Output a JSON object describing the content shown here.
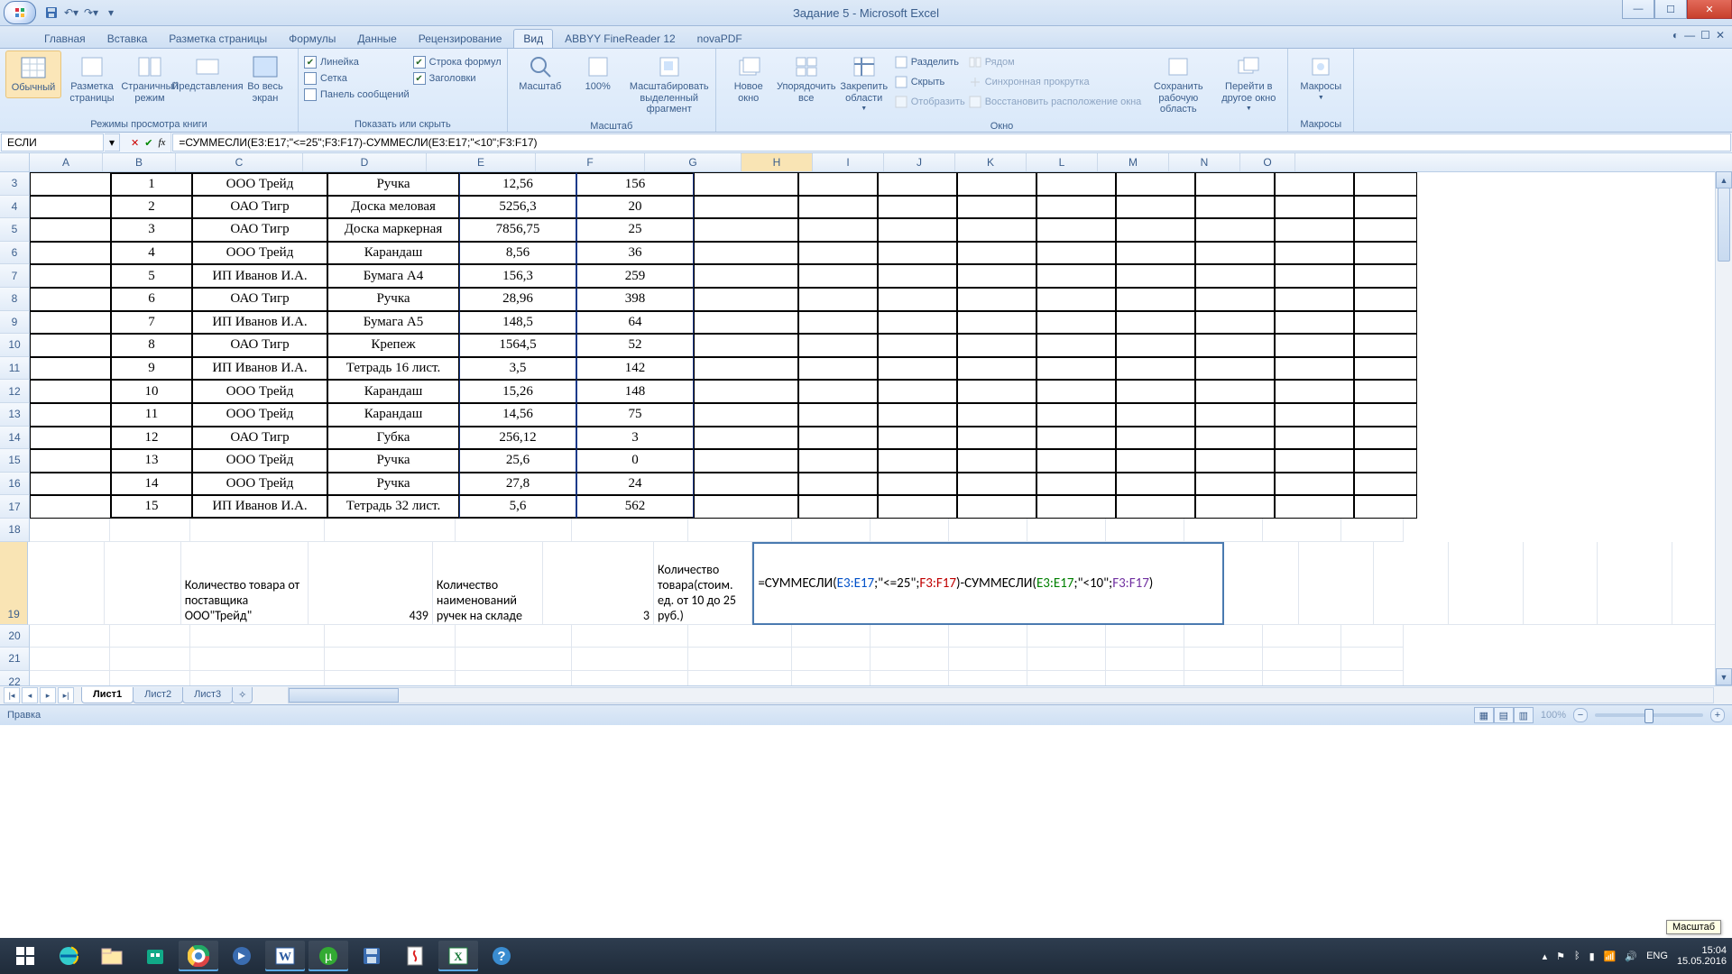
{
  "title": "Задание 5 - Microsoft Excel",
  "tabs": [
    "Главная",
    "Вставка",
    "Разметка страницы",
    "Формулы",
    "Данные",
    "Рецензирование",
    "Вид",
    "ABBYY FineReader 12",
    "novaPDF"
  ],
  "active_tab": "Вид",
  "ribbon": {
    "g1": {
      "label": "Режимы просмотра книги",
      "btns": [
        "Обычный",
        "Разметка страницы",
        "Страничный режим",
        "Представления",
        "Во весь экран"
      ]
    },
    "g2": {
      "label": "Показать или скрыть",
      "chk": [
        {
          "c": true,
          "t": "Линейка"
        },
        {
          "c": true,
          "t": "Строка формул"
        },
        {
          "c": false,
          "t": "Сетка"
        },
        {
          "c": true,
          "t": "Заголовки"
        },
        {
          "c": false,
          "t": "Панель сообщений"
        }
      ]
    },
    "g3": {
      "label": "Масштаб",
      "btns": [
        "Масштаб",
        "100%",
        "Масштабировать выделенный фрагмент"
      ]
    },
    "g4": {
      "label": "Окно",
      "btns": [
        "Новое окно",
        "Упорядочить все",
        "Закрепить области"
      ],
      "rows": [
        "Разделить",
        "Скрыть",
        "Отобразить"
      ],
      "rows2": [
        "Рядом",
        "Синхронная прокрутка",
        "Восстановить расположение окна"
      ],
      "btns2": [
        "Сохранить рабочую область",
        "Перейти в другое окно"
      ]
    },
    "g5": {
      "label": "Макросы",
      "btn": "Макросы"
    }
  },
  "namebox": "ЕСЛИ",
  "formula": "=СУММЕСЛИ(E3:E17;\"<=25\";F3:F17)-СУММЕСЛИ(E3:E17;\"<10\";F3:F17)",
  "columns": [
    "A",
    "B",
    "C",
    "D",
    "E",
    "F",
    "G",
    "H",
    "I",
    "J",
    "K",
    "L",
    "M",
    "N",
    "O"
  ],
  "active_col": "H",
  "rows_visible": [
    3,
    4,
    5,
    6,
    7,
    8,
    9,
    10,
    11,
    12,
    13,
    14,
    15,
    16,
    17,
    18,
    19,
    20,
    21,
    22
  ],
  "active_row": 19,
  "table": [
    {
      "n": "1",
      "sup": "ООО Трейд",
      "item": "Ручка",
      "price": "12,56",
      "qty": "156"
    },
    {
      "n": "2",
      "sup": "ОАО Тигр",
      "item": "Доска меловая",
      "price": "5256,3",
      "qty": "20"
    },
    {
      "n": "3",
      "sup": "ОАО Тигр",
      "item": "Доска маркерная",
      "price": "7856,75",
      "qty": "25"
    },
    {
      "n": "4",
      "sup": "ООО Трейд",
      "item": "Карандаш",
      "price": "8,56",
      "qty": "36"
    },
    {
      "n": "5",
      "sup": "ИП Иванов И.А.",
      "item": "Бумага А4",
      "price": "156,3",
      "qty": "259"
    },
    {
      "n": "6",
      "sup": "ОАО Тигр",
      "item": "Ручка",
      "price": "28,96",
      "qty": "398"
    },
    {
      "n": "7",
      "sup": "ИП Иванов И.А.",
      "item": "Бумага А5",
      "price": "148,5",
      "qty": "64"
    },
    {
      "n": "8",
      "sup": "ОАО Тигр",
      "item": "Крепеж",
      "price": "1564,5",
      "qty": "52"
    },
    {
      "n": "9",
      "sup": "ИП Иванов И.А.",
      "item": "Тетрадь 16 лист.",
      "price": "3,5",
      "qty": "142"
    },
    {
      "n": "10",
      "sup": "ООО Трейд",
      "item": "Карандаш",
      "price": "15,26",
      "qty": "148"
    },
    {
      "n": "11",
      "sup": "ООО Трейд",
      "item": "Карандаш",
      "price": "14,56",
      "qty": "75"
    },
    {
      "n": "12",
      "sup": "ОАО Тигр",
      "item": "Губка",
      "price": "256,12",
      "qty": "3"
    },
    {
      "n": "13",
      "sup": "ООО Трейд",
      "item": "Ручка",
      "price": "25,6",
      "qty": "0"
    },
    {
      "n": "14",
      "sup": "ООО Трейд",
      "item": "Ручка",
      "price": "27,8",
      "qty": "24"
    },
    {
      "n": "15",
      "sup": "ИП Иванов И.А.",
      "item": "Тетрадь 32 лист.",
      "price": "5,6",
      "qty": "562"
    }
  ],
  "summary": {
    "c19": "Количество товара от поставщика ООО\"Трейд\"",
    "d19": "439",
    "e19": "Количество наименований ручек на складе",
    "f19": "3",
    "g19": "Количество товара(стоим. ед. от 10 до 25 руб.)"
  },
  "edit_cell": {
    "parts": [
      {
        "t": "=СУММЕСЛИ(",
        "c": "black"
      },
      {
        "t": "E3:E17",
        "c": "blue"
      },
      {
        "t": ";\"<=25\";",
        "c": "black"
      },
      {
        "t": "F3:F17",
        "c": "red"
      },
      {
        "t": ")-СУММЕСЛИ(",
        "c": "black"
      },
      {
        "t": "E3:E17",
        "c": "green"
      },
      {
        "t": ";\"<10\";",
        "c": "black"
      },
      {
        "t": "F3:F17",
        "c": "purple"
      },
      {
        "t": ")",
        "c": "black"
      }
    ]
  },
  "sheets": [
    "Лист1",
    "Лист2",
    "Лист3"
  ],
  "active_sheet": "Лист1",
  "status": "Правка",
  "zoom": "100%",
  "tooltip": "Масштаб",
  "tray": {
    "lang": "ENG",
    "time": "15:04",
    "date": "15.05.2016"
  }
}
